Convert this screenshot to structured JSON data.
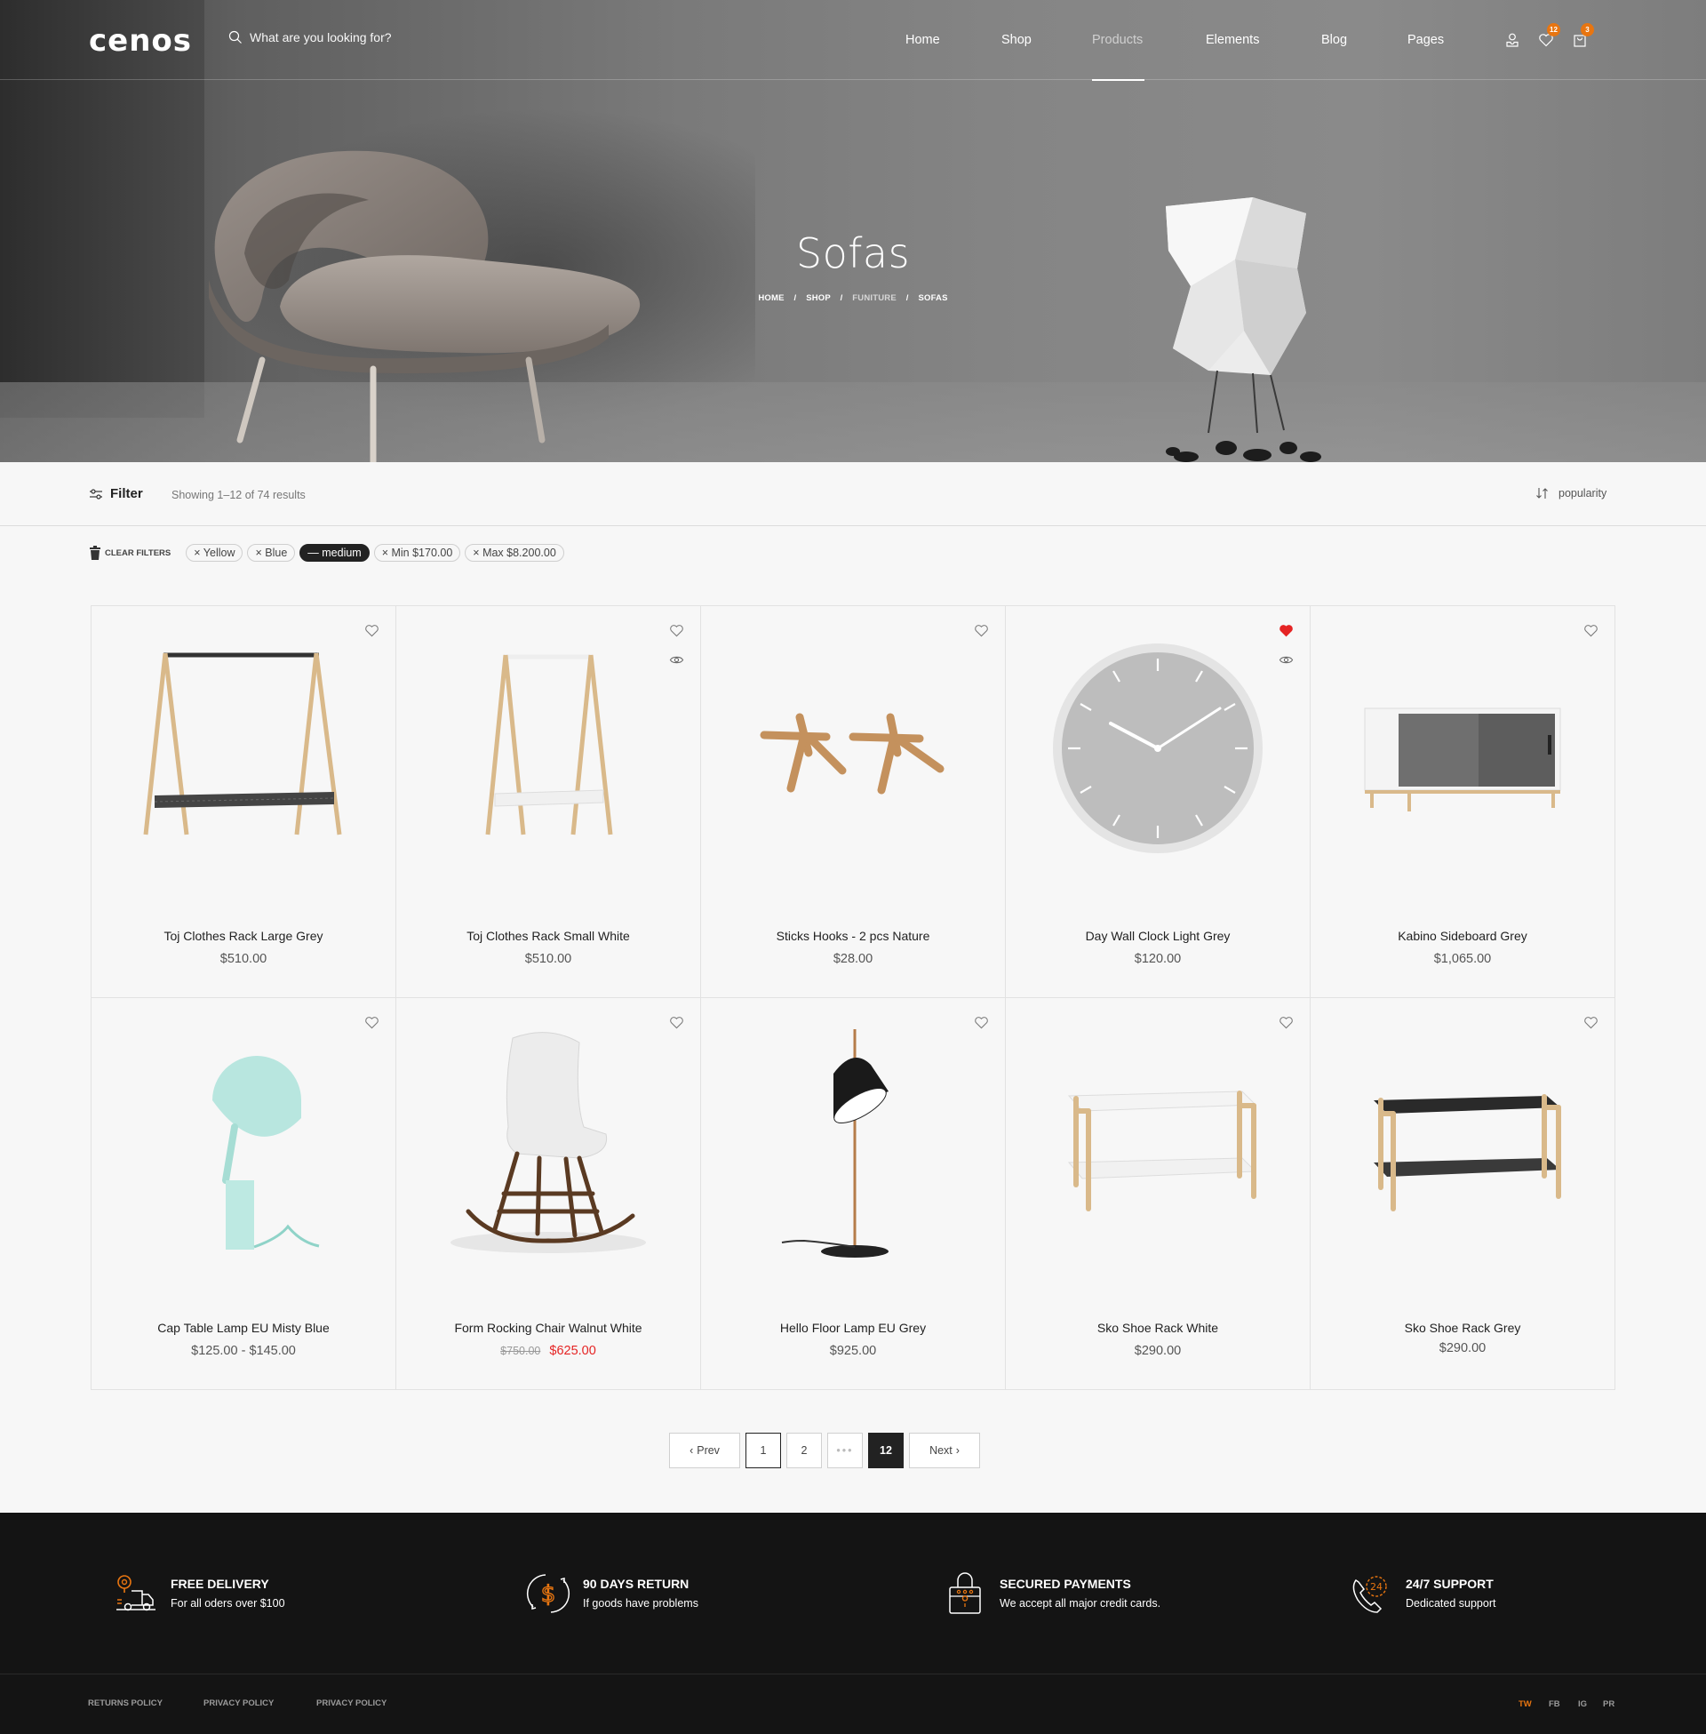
{
  "brand": {
    "logo": "cenos",
    "accent": "#e87510",
    "sale_color": "#e52424"
  },
  "header": {
    "search_placeholder": "What are you looking for?",
    "nav": [
      {
        "label": "Home",
        "active": false
      },
      {
        "label": "Shop",
        "active": false
      },
      {
        "label": "Products",
        "active": true
      },
      {
        "label": "Elements",
        "active": false
      },
      {
        "label": "Blog",
        "active": false
      },
      {
        "label": "Pages",
        "active": false
      }
    ],
    "icons": {
      "account": "user-icon",
      "wishlist": "heart-icon",
      "wishlist_count": "12",
      "cart": "shopping-bag-icon",
      "cart_count": "3"
    }
  },
  "hero": {
    "title": "Sofas",
    "breadcrumb": [
      {
        "label": "HOME",
        "muted": false
      },
      {
        "label": "SHOP",
        "muted": false
      },
      {
        "label": "FUNITURE",
        "muted": true
      },
      {
        "label": "SOFAS",
        "muted": false
      }
    ],
    "separator": "/"
  },
  "toolbar": {
    "filter_label": "Filter",
    "result_count": "Showing 1–12 of 74 results",
    "sort_label": "popularity"
  },
  "active_filters": {
    "clear_label": "CLEAR FILTERS",
    "chips": [
      {
        "label": "× Yellow",
        "selected": false
      },
      {
        "label": "× Blue",
        "selected": false
      },
      {
        "label": "— medium",
        "selected": true
      },
      {
        "label": "× Min $170.00",
        "selected": false
      },
      {
        "label": "× Max $8.200.00",
        "selected": false
      }
    ]
  },
  "products": [
    {
      "name": "Toj Clothes Rack Large Grey",
      "price": "$510.00",
      "wishlisted": false,
      "quick_view": false,
      "image": "clothes-rack-large"
    },
    {
      "name": "Toj Clothes Rack Small White",
      "price": "$510.00",
      "wishlisted": false,
      "quick_view": true,
      "image": "clothes-rack-small"
    },
    {
      "name": "Sticks Hooks - 2 pcs Nature",
      "price": "$28.00",
      "wishlisted": false,
      "quick_view": false,
      "image": "sticks-hooks"
    },
    {
      "name": "Day Wall Clock Light Grey",
      "price": "$120.00",
      "wishlisted": true,
      "quick_view": true,
      "image": "wall-clock"
    },
    {
      "name": "Kabino Sideboard Grey",
      "price": "$1,065.00",
      "wishlisted": false,
      "quick_view": false,
      "image": "sideboard"
    },
    {
      "name": "Cap Table Lamp EU Misty Blue",
      "price": "$125.00 - $145.00",
      "wishlisted": false,
      "quick_view": false,
      "image": "table-lamp"
    },
    {
      "name": "Form Rocking Chair Walnut White",
      "old_price": "$750.00",
      "price": "$625.00",
      "on_sale": true,
      "wishlisted": false,
      "quick_view": false,
      "image": "rocking-chair"
    },
    {
      "name": "Hello Floor Lamp EU Grey",
      "price": "$925.00",
      "wishlisted": false,
      "quick_view": false,
      "image": "floor-lamp"
    },
    {
      "name": "Sko Shoe Rack White",
      "price": "$290.00",
      "wishlisted": false,
      "quick_view": false,
      "image": "shoe-rack-white"
    },
    {
      "name": "Sko Shoe Rack Grey",
      "price": "$290.00",
      "wishlisted": false,
      "quick_view": false,
      "image": "shoe-rack-grey"
    }
  ],
  "pagination": {
    "prev": "Prev",
    "next": "Next",
    "pages": [
      "1",
      "2",
      "•••",
      "12"
    ],
    "current": "1",
    "highlighted": "12"
  },
  "footer": {
    "features": [
      {
        "title": "FREE DELIVERY",
        "subtitle": "For all oders over $100",
        "icon": "delivery-truck-icon"
      },
      {
        "title": "90 DAYS RETURN",
        "subtitle": "If goods have problems",
        "icon": "money-return-icon"
      },
      {
        "title": "SECURED PAYMENTS",
        "subtitle": "We accept all major credit cards.",
        "icon": "padlock-icon"
      },
      {
        "title": "24/7 SUPPORT",
        "subtitle": "Dedicated support",
        "icon": "phone-24-icon"
      }
    ],
    "links": [
      "RETURNS POLICY",
      "PRIVACY POLICY",
      "PRIVACY POLICY"
    ],
    "social": [
      {
        "label": "TW",
        "active": true
      },
      {
        "label": "FB",
        "active": false
      },
      {
        "label": "IG",
        "active": false
      },
      {
        "label": "PR",
        "active": false
      }
    ]
  }
}
